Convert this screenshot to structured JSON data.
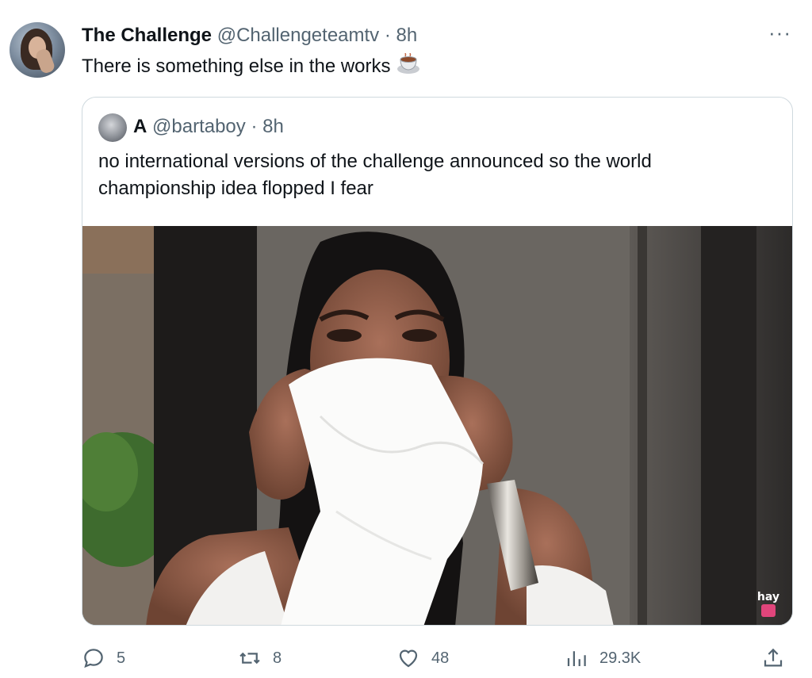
{
  "tweet": {
    "display_name": "The Challenge",
    "handle": "@Challengeteamtv",
    "separator": "·",
    "time": "8h",
    "text": "There is something else in the works",
    "emoji_icon": "tea-cup-icon",
    "more_label": "···"
  },
  "quote": {
    "display_name": "A",
    "handle": "@bartaboy",
    "separator": "·",
    "time": "8h",
    "text_lines": [
      "no international versions of the challenge announced so the world",
      "championship idea flopped I fear"
    ],
    "media": {
      "watermark_text": "hay",
      "description_icon": "photo-woman-covering-face-with-napkin"
    }
  },
  "actions": {
    "reply": {
      "icon": "reply-icon",
      "count": "5"
    },
    "repost": {
      "icon": "repost-icon",
      "count": "8"
    },
    "like": {
      "icon": "heart-icon",
      "count": "48"
    },
    "views": {
      "icon": "views-chart-icon",
      "count": "29.3K"
    },
    "share": {
      "icon": "share-icon"
    }
  },
  "colors": {
    "text_primary": "#0f1419",
    "text_secondary": "#536471",
    "border": "#cfd9de"
  }
}
